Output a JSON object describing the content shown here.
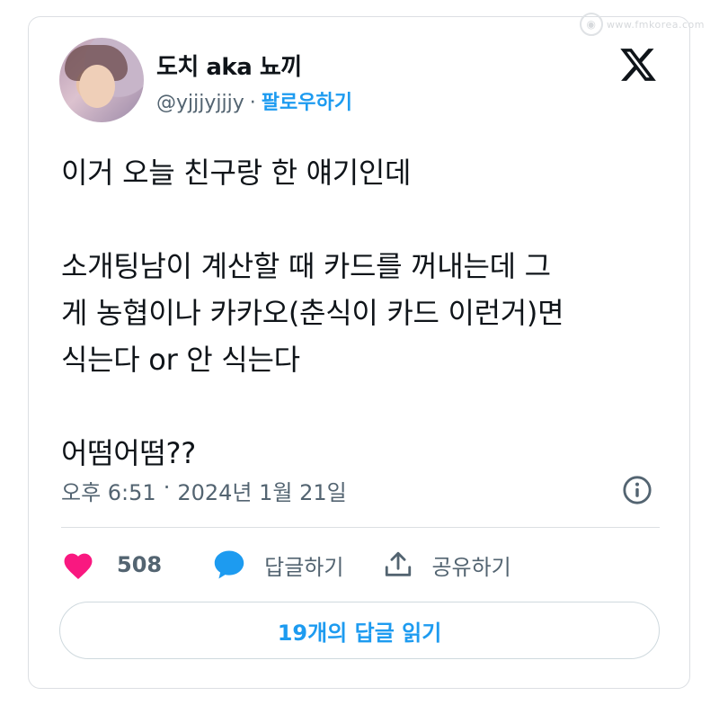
{
  "watermark": {
    "text": "www.fmkorea.com"
  },
  "author": {
    "display_name": "도치 aka 뇨끼",
    "handle": "@yjjjyjjjy",
    "separator": "·",
    "follow_label": "팔로우하기"
  },
  "tweet": {
    "lines": [
      "이거 오늘 친구랑 한 얘기인데",
      "",
      "소개팅남이 계산할 때 카드를 꺼내는데 그",
      "게 농협이나 카카오(춘식이 카드 이런거)면",
      "식는다 or 안 식는다",
      "",
      "어떰어떰??"
    ],
    "time": "오후 6:51",
    "separator": "·",
    "date": "2024년 1월 21일"
  },
  "actions": {
    "like_count": "508",
    "reply_label": "답글하기",
    "share_label": "공유하기"
  },
  "read_replies_label": "19개의 답글 읽기",
  "icons": {
    "like": "heart-icon",
    "reply": "speech-bubble-icon",
    "share": "share-upload-icon",
    "info": "info-icon",
    "brand": "x-logo-icon"
  },
  "colors": {
    "accent": "#1d9bf0",
    "like": "#f91880",
    "text": "#0f1419",
    "muted": "#536471",
    "border": "#dcdfe3"
  }
}
